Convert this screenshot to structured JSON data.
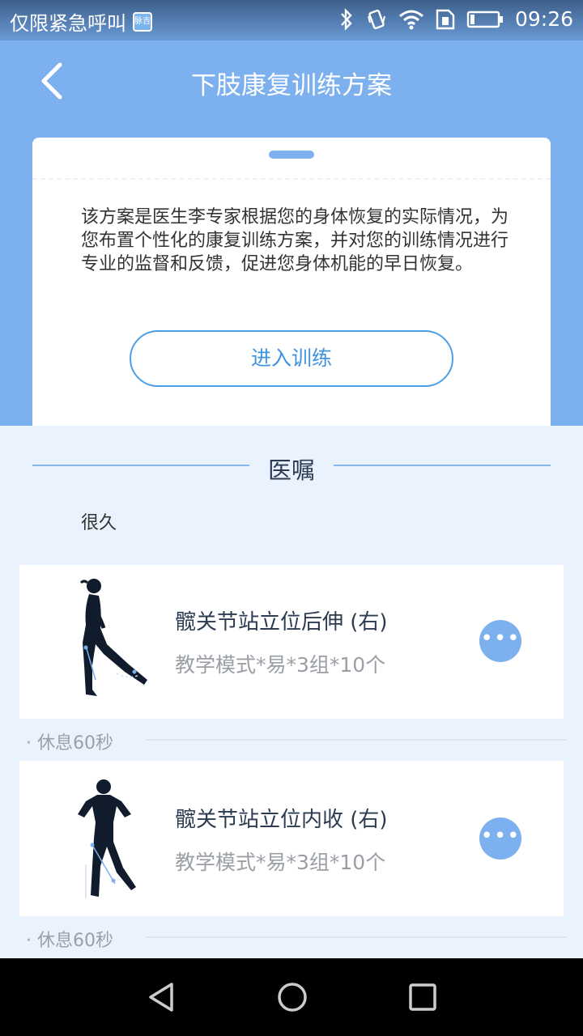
{
  "status_bar": {
    "left_text": "仅限紧急呼叫",
    "app_badge": "脉吉",
    "time": "09:26",
    "icons": [
      "bluetooth-icon",
      "vibrate-icon",
      "wifi-icon",
      "sim-card-icon",
      "battery-icon"
    ]
  },
  "header": {
    "title": "下肢康复训练方案",
    "back_icon": "chevron-left-icon",
    "background_color": "#7db0ee"
  },
  "plan_card": {
    "description": "该方案是医生李专家根据您的身体恢复的实际情况，为您布置个性化的康复训练方案，并对您的训练情况进行专业的监督和反馈，促进您身体机能的早日恢复。",
    "enter_button": "进入训练"
  },
  "advice": {
    "section_title": "医嘱",
    "text": "很久"
  },
  "exercises": [
    {
      "name": "髋关节站立位后伸 (右)",
      "detail": "教学模式*易*3组*10个",
      "figure_icon": "hip-extension-figure-icon",
      "more_icon": "more-dots-icon",
      "rest": "· 休息60秒"
    },
    {
      "name": "髋关节站立位内收 (右)",
      "detail": "教学模式*易*3组*10个",
      "figure_icon": "hip-adduction-figure-icon",
      "more_icon": "more-dots-icon",
      "rest": "· 休息60秒"
    }
  ],
  "nav_bar": {
    "icons": [
      "back-triangle-icon",
      "home-circle-icon",
      "recents-square-icon"
    ]
  },
  "colors": {
    "accent": "#7db0ee",
    "button_border": "#4ea0e6",
    "page_background": "#eaf3fd"
  }
}
